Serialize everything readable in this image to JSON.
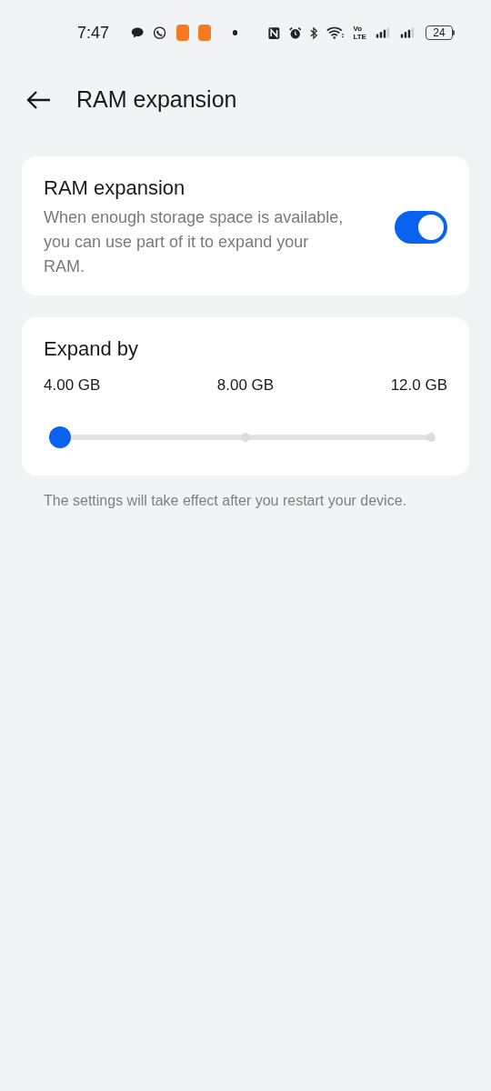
{
  "status_bar": {
    "time": "7:47",
    "volte": [
      "Vo",
      "LTE"
    ],
    "battery": "24"
  },
  "header": {
    "title": "RAM expansion"
  },
  "toggle_card": {
    "title": "RAM expansion",
    "description": "When enough storage space is available, you can use part of it to expand your RAM.",
    "on": true
  },
  "expand_card": {
    "title": "Expand by",
    "labels": [
      "4.00 GB",
      "8.00 GB",
      "12.0 GB"
    ],
    "level": 0
  },
  "footnote": "The settings will take effect after you restart your device."
}
